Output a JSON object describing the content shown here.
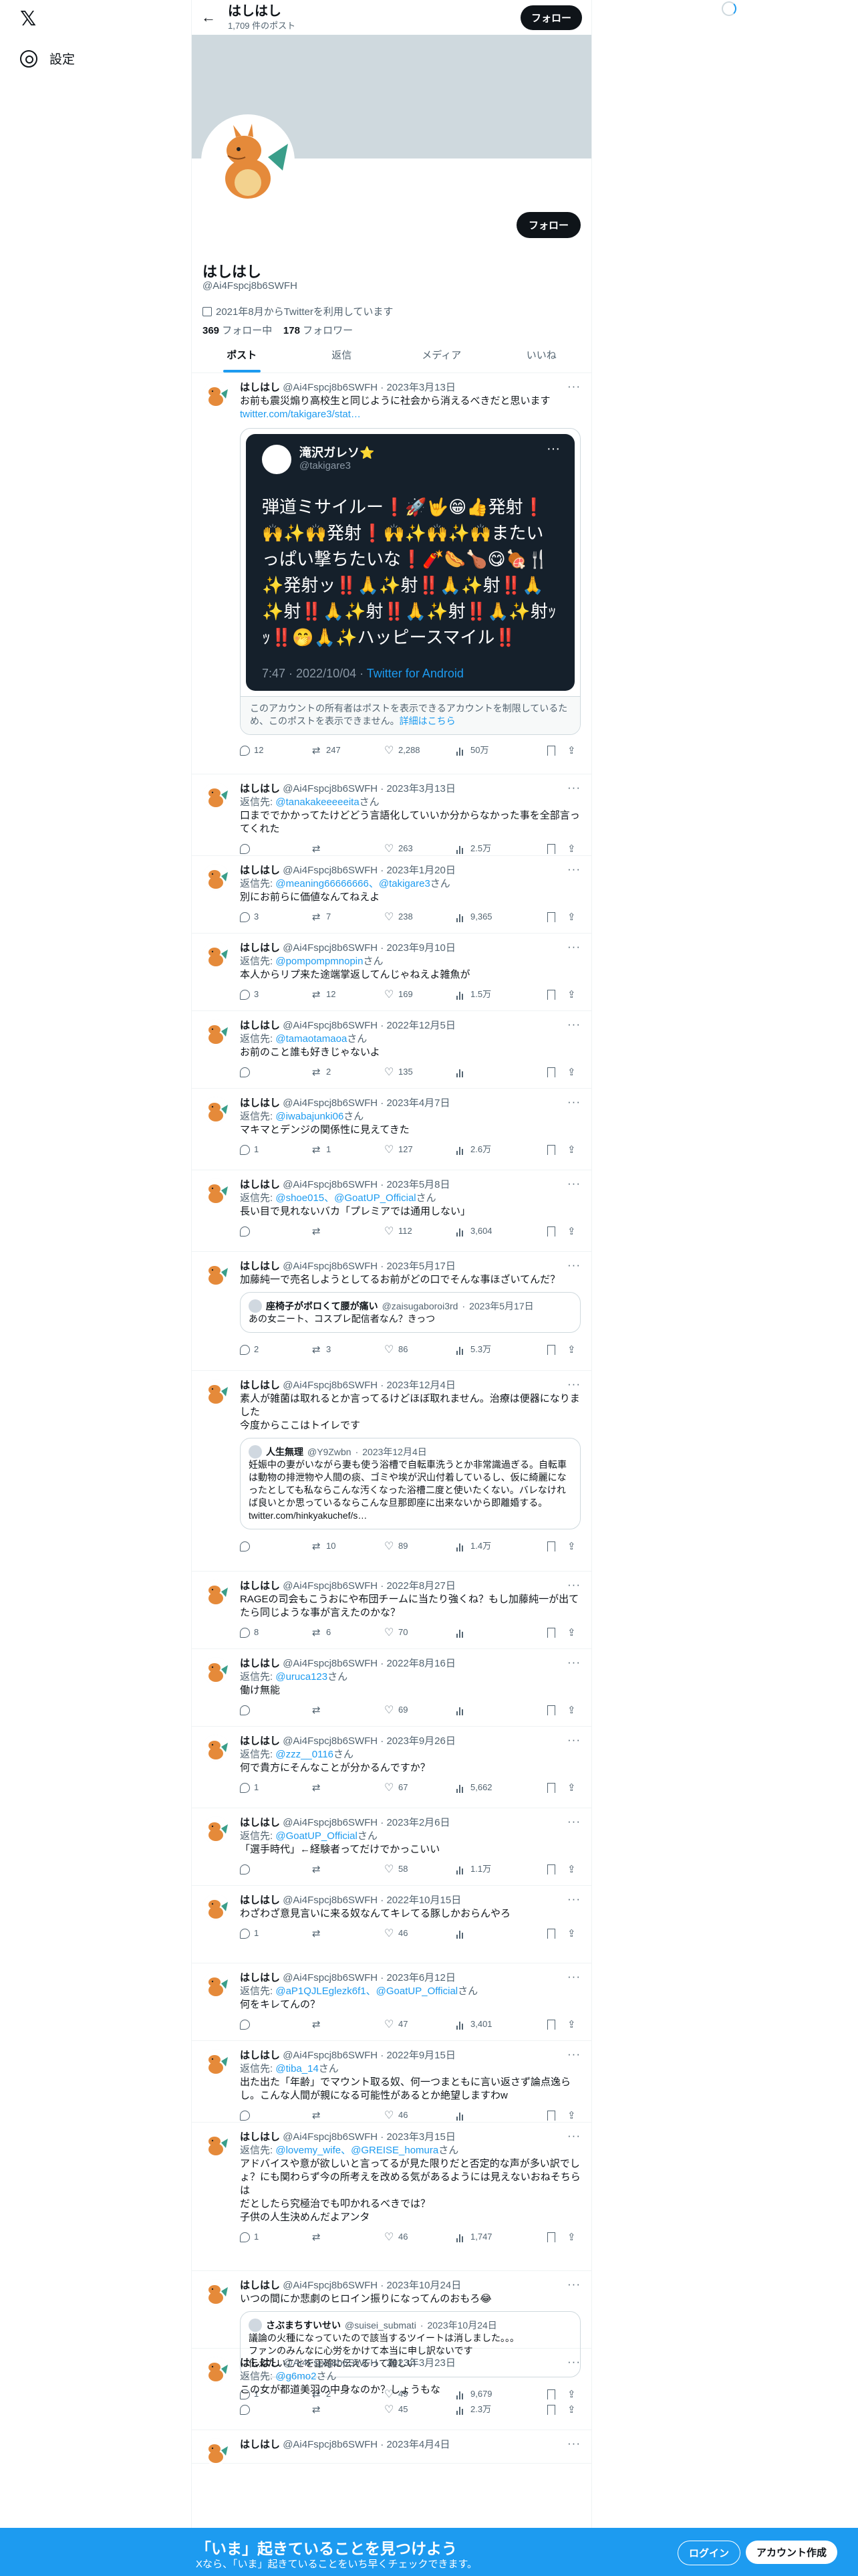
{
  "nav": {
    "logo": "𝕏",
    "settings": "設定"
  },
  "header": {
    "name": "はしはし",
    "post_count": "1,709 件のポスト",
    "follow": "フォロー"
  },
  "profile": {
    "name": "はしはし",
    "handle": "@Ai4Fspcj8b6SWFH",
    "joined": "2021年8月からTwitterを利用しています",
    "following_count": "369",
    "following_label": "フォロー中",
    "followers_count": "178",
    "followers_label": "フォロワー",
    "follow": "フォロー"
  },
  "tabs": [
    "ポスト",
    "返信",
    "メディア",
    "いいね"
  ],
  "tweets": [
    {
      "name": "はしはし",
      "handle": "@Ai4Fspcj8b6SWFH",
      "date": "2023年3月13日",
      "reply_to": "",
      "text": "お前も震災煽り高校生と同じように社会から消えるべきだと思います",
      "link": "twitter.com/takigare3/stat…",
      "replies": "12",
      "retweets": "247",
      "likes": "2,288",
      "views": "50万"
    },
    {
      "name": "はしはし",
      "handle": "@Ai4Fspcj8b6SWFH",
      "date": "2023年3月13日",
      "reply_to": "@tanakakeeeeeita",
      "text": "口まででかかってたけどどう言語化していいか分からなかった事を全部言ってくれた",
      "replies": "",
      "retweets": "",
      "likes": "263",
      "views": "2.5万"
    },
    {
      "name": "はしはし",
      "handle": "@Ai4Fspcj8b6SWFH",
      "date": "2023年1月20日",
      "reply_to": "@meaning66666666、@takigare3",
      "text": "別にお前らに価値なんてねえよ",
      "replies": "3",
      "retweets": "7",
      "likes": "238",
      "views": "9,365"
    },
    {
      "name": "はしはし",
      "handle": "@Ai4Fspcj8b6SWFH",
      "date": "2023年9月10日",
      "reply_to": "@pompompmnopin",
      "text": "本人からリプ来た途端掌返してんじゃねえよ雑魚が",
      "replies": "3",
      "retweets": "12",
      "likes": "169",
      "views": "1.5万"
    },
    {
      "name": "はしはし",
      "handle": "@Ai4Fspcj8b6SWFH",
      "date": "2022年12月5日",
      "reply_to": "@tamaotamaoa",
      "text": "お前のこと誰も好きじゃないよ",
      "replies": "",
      "retweets": "2",
      "likes": "135",
      "views": ""
    },
    {
      "name": "はしはし",
      "handle": "@Ai4Fspcj8b6SWFH",
      "date": "2023年4月7日",
      "reply_to": "@iwabajunki06",
      "text": "マキマとデンジの関係性に見えてきた",
      "replies": "1",
      "retweets": "1",
      "likes": "127",
      "views": "2.6万"
    },
    {
      "name": "はしはし",
      "handle": "@Ai4Fspcj8b6SWFH",
      "date": "2023年5月8日",
      "reply_to": "@shoe015、@GoatUP_Official",
      "text": "長い目で見れないバカ「プレミアでは通用しない」",
      "replies": "",
      "retweets": "",
      "likes": "112",
      "views": "3,604"
    },
    {
      "name": "はしはし",
      "handle": "@Ai4Fspcj8b6SWFH",
      "date": "2023年5月17日",
      "reply_to": "",
      "text": "加藤純一で売名しようとしてるお前がどの口でそんな事ほざいてんだ？",
      "quote": {
        "name": "座椅子がボロくて腰が痛い",
        "handle": "@zaisugaboroi3rd",
        "date": "2023年5月17日",
        "text": "あの女ニート、コスプレ配信者なん？きっつ"
      },
      "replies": "2",
      "retweets": "3",
      "likes": "86",
      "views": "5.3万"
    },
    {
      "name": "はしはし",
      "handle": "@Ai4Fspcj8b6SWFH",
      "date": "2023年12月4日",
      "reply_to": "",
      "text": "素人が雑菌は取れるとか言ってるけどほぼ取れません。治療は便器になりました\n今度からここはトイレです",
      "quote": {
        "name": "人生無理",
        "handle": "@Y9Zwbn",
        "date": "2023年12月4日",
        "text": "妊娠中の妻がいながら妻も使う浴槽で自転車洗うとか非常識過ぎる。自転車は動物の排泄物や人間の痰、ゴミや埃が沢山付着しているし、仮に綺麗になったとしても私ならこんな汚くなった浴槽二度と使いたくない。バレなければ良いとか思っているならこんな旦那即座に出来ないから即離婚する。twitter.com/hinkyakuchef/s…"
      },
      "replies": "",
      "retweets": "10",
      "likes": "89",
      "views": "1.4万"
    },
    {
      "name": "はしはし",
      "handle": "@Ai4Fspcj8b6SWFH",
      "date": "2022年8月27日",
      "reply_to": "",
      "text": "RAGEの司会もこうおにや布団チームに当たり強くね？もし加藤純一が出てたら同じような事が言えたのかな？",
      "replies": "8",
      "retweets": "6",
      "likes": "70",
      "views": ""
    },
    {
      "name": "はしはし",
      "handle": "@Ai4Fspcj8b6SWFH",
      "date": "2022年8月16日",
      "reply_to": "@uruca123",
      "text": "働け無能",
      "replies": "",
      "retweets": "",
      "likes": "69",
      "views": ""
    },
    {
      "name": "はしはし",
      "handle": "@Ai4Fspcj8b6SWFH",
      "date": "2023年9月26日",
      "reply_to": "@zzz__0116",
      "text": "何で貴方にそんなことが分かるんですか？",
      "replies": "1",
      "retweets": "",
      "likes": "67",
      "views": "5,662"
    },
    {
      "name": "はしはし",
      "handle": "@Ai4Fspcj8b6SWFH",
      "date": "2023年2月6日",
      "reply_to": "@GoatUP_Official",
      "text": "「選手時代」←経験者ってだけでかっこいい",
      "replies": "",
      "retweets": "",
      "likes": "58",
      "views": "1.1万"
    },
    {
      "name": "はしはし",
      "handle": "@Ai4Fspcj8b6SWFH",
      "date": "2022年10月15日",
      "reply_to": "",
      "text": "わざわざ意見言いに来る奴なんてキレてる豚しかおらんやろ",
      "replies": "1",
      "retweets": "",
      "likes": "46",
      "views": ""
    },
    {
      "name": "はしはし",
      "handle": "@Ai4Fspcj8b6SWFH",
      "date": "2023年6月12日",
      "reply_to": "@aP1QJLEglezk6f1、@GoatUP_Official",
      "text": "何をキレてんの？",
      "replies": "",
      "retweets": "",
      "likes": "47",
      "views": "3,401"
    },
    {
      "name": "はしはし",
      "handle": "@Ai4Fspcj8b6SWFH",
      "date": "2022年9月15日",
      "reply_to": "@tiba_14",
      "text": "出た出た「年齢」でマウント取る奴、何一つまともに言い返さず論点逸らし。こんな人間が親になる可能性があるとか絶望しますわw",
      "replies": "",
      "retweets": "",
      "likes": "46",
      "views": ""
    },
    {
      "name": "はしはし",
      "handle": "@Ai4Fspcj8b6SWFH",
      "date": "2023年3月15日",
      "reply_to": "@lovemy_wife、@GREISE_homura",
      "text": "アドバイスや意が欲しいと言ってるが見た限りだと否定的な声が多い訳でしょ？にも関わらず今の所考えを改める気があるようには見えないおねそちらは\nだとしたら究極治でも叩かれるべきでは？\n子供の人生決めんだよアンタ",
      "replies": "1",
      "retweets": "",
      "likes": "46",
      "views": "1,747"
    },
    {
      "name": "はしはし",
      "handle": "@Ai4Fspcj8b6SWFH",
      "date": "2023年10月24日",
      "reply_to": "",
      "text": "いつの間にか悲劇のヒロイン振りになってんのおもろ😂",
      "quote": {
        "name": "さぶまちすいせい",
        "handle": "@suisei_submati",
        "date": "2023年10月24日",
        "text": "議論の火種になっていたので該当するツイートは消しました。。。\nファンのみんなに心労をかけて本当に申し訳ないです\n伝えたいことを正確に伝えるって難しい"
      },
      "replies": "1",
      "retweets": "2",
      "likes": "49",
      "views": "9,679"
    },
    {
      "name": "はしはし",
      "handle": "@Ai4Fspcj8b6SWFH",
      "date": "2023年3月23日",
      "reply_to": "@g6mo2",
      "text": "この女が都道美羽の中身なのか？しょうもな",
      "replies": "",
      "retweets": "",
      "likes": "45",
      "views": "2.3万"
    },
    {
      "name": "はしはし",
      "handle": "@Ai4Fspcj8b6SWFH",
      "date": "2023年4月4日",
      "reply_to": "",
      "text": "",
      "replies": "",
      "retweets": "",
      "likes": "",
      "views": ""
    }
  ],
  "embed": {
    "name": "滝沢ガレソ⭐️",
    "handle": "@takigare3",
    "text": "弾道ミサイルー❗️🚀🤟😁👍発射❗️🙌✨🙌発射❗️🙌✨🙌✨🙌またいっぱい撃ちたいな❗️🧨🌭🍗😋🍖🍴✨発射ッ‼️🙏✨射‼️🙏✨射‼️🙏✨射‼️🙏✨射‼️🙏✨射‼️🙏✨射ｯｯ‼️🤭🙏✨ハッピースマイル‼️",
    "time": "7:47 · 2022/10/04 · ",
    "source": "Twitter for Android",
    "notice": "このアカウントの所有者はポストを表示できるアカウントを制限しているため、このポストを表示できません。",
    "notice_link": "詳細はこちら"
  },
  "bottom": {
    "title": "「いま」起きていることを見つけよう",
    "subtitle": "Xなら、「いま」起きていることをいち早くチェックできます。",
    "login": "ログイン",
    "signup": "アカウント作成"
  }
}
